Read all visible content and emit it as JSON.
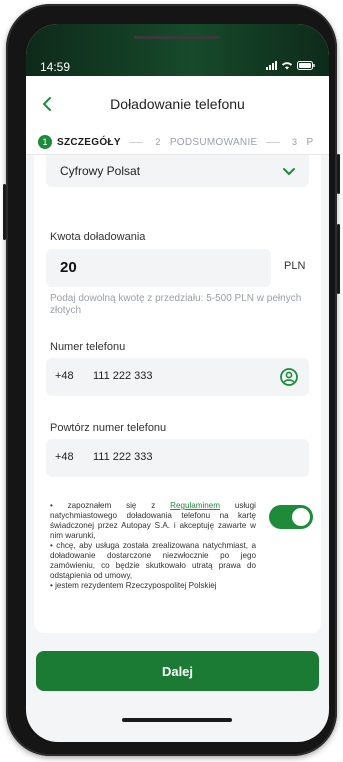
{
  "status_bar": {
    "time": "14:59"
  },
  "header": {
    "title": "Doładowanie telefonu"
  },
  "steps": [
    {
      "num": "1",
      "label": "SZCZEGÓŁY"
    },
    {
      "num": "2",
      "label": "PODSUMOWANIE"
    },
    {
      "num": "3",
      "label": "P"
    }
  ],
  "operator": {
    "value": "Cyfrowy Polsat"
  },
  "amount": {
    "label": "Kwota doładowania",
    "value": "20",
    "currency": "PLN",
    "hint": "Podaj dowolną kwotę z przedziału: 5-500 PLN w pełnych złotych"
  },
  "phone": {
    "label": "Numer telefonu",
    "prefix": "+48",
    "value": "111 222 333"
  },
  "phone_repeat": {
    "label": "Powtórz numer telefonu",
    "prefix": "+48",
    "value": "111 222 333"
  },
  "consent": {
    "text_before": "• zapoznałem się z ",
    "link": "Regulaminem",
    "text_after": " usługi natychmiastowego doładowania telefonu na kartę świadczonej przez Autopay S.A. i akceptuję zawarte w nim warunki,",
    "line2": "• chcę, aby usługa została zrealizowana natychmiast, a doładowanie dostarczone niezwłocznie po jego zamówieniu, co będzie skutkowało utratą prawa do odstąpienia od umowy,",
    "line3": "• jestem rezydentem Rzeczypospolitej Polskiej",
    "toggle_on": true
  },
  "actions": {
    "next_label": "Dalej"
  },
  "colors": {
    "accent": "#1e8b3b",
    "button": "#1b7b34"
  }
}
